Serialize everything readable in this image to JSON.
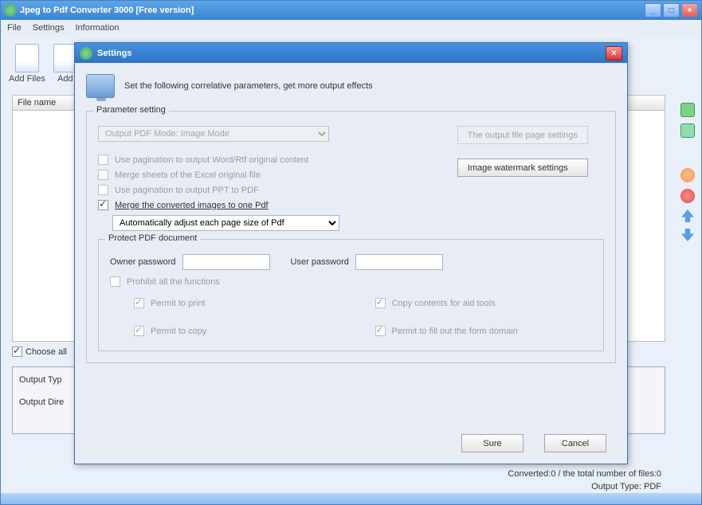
{
  "main": {
    "title": "Jpeg to Pdf Converter 3000 [Free version]",
    "menu": {
      "file": "File",
      "settings": "Settings",
      "information": "Information"
    },
    "toolbar": {
      "addfiles": "Add Files",
      "addfolder": "Add"
    },
    "grid": {
      "header_filename": "File name"
    },
    "choose_all": "Choose all",
    "output_type_label": "Output Typ",
    "output_dir_label": "Output Dire",
    "status": "Converted:0  /  the total number of files:0",
    "output_type": "Output Type: PDF"
  },
  "modal": {
    "title": "Settings",
    "intro": "Set the following correlative parameters, get more output effects",
    "fieldset_title": "Parameter setting",
    "pdf_mode": "Output PDF Mode: Image Mode",
    "btn_page_settings": "The output file page settings",
    "btn_watermark": "Image watermark settings",
    "cb_pagination_word": "Use pagination to output Word/Rtf original content",
    "cb_merge_excel": "Merge sheets of the Excel original file",
    "cb_pagination_ppt": "Use pagination to output PPT to PDF",
    "cb_merge_images": "Merge the converted images to one Pdf",
    "page_size_option": "Automatically adjust each page size of Pdf",
    "protect": {
      "title": "Protect PDF document",
      "owner_label": "Owner password",
      "user_label": "User password",
      "prohibit": "Prohibit all the functions",
      "permit_print": "Permit to print",
      "permit_copy": "Permit to copy",
      "permit_copytools": "Copy contents for aid tools",
      "permit_form": "Permit to fill out the form domain"
    },
    "sure": "Sure",
    "cancel": "Cancel"
  }
}
